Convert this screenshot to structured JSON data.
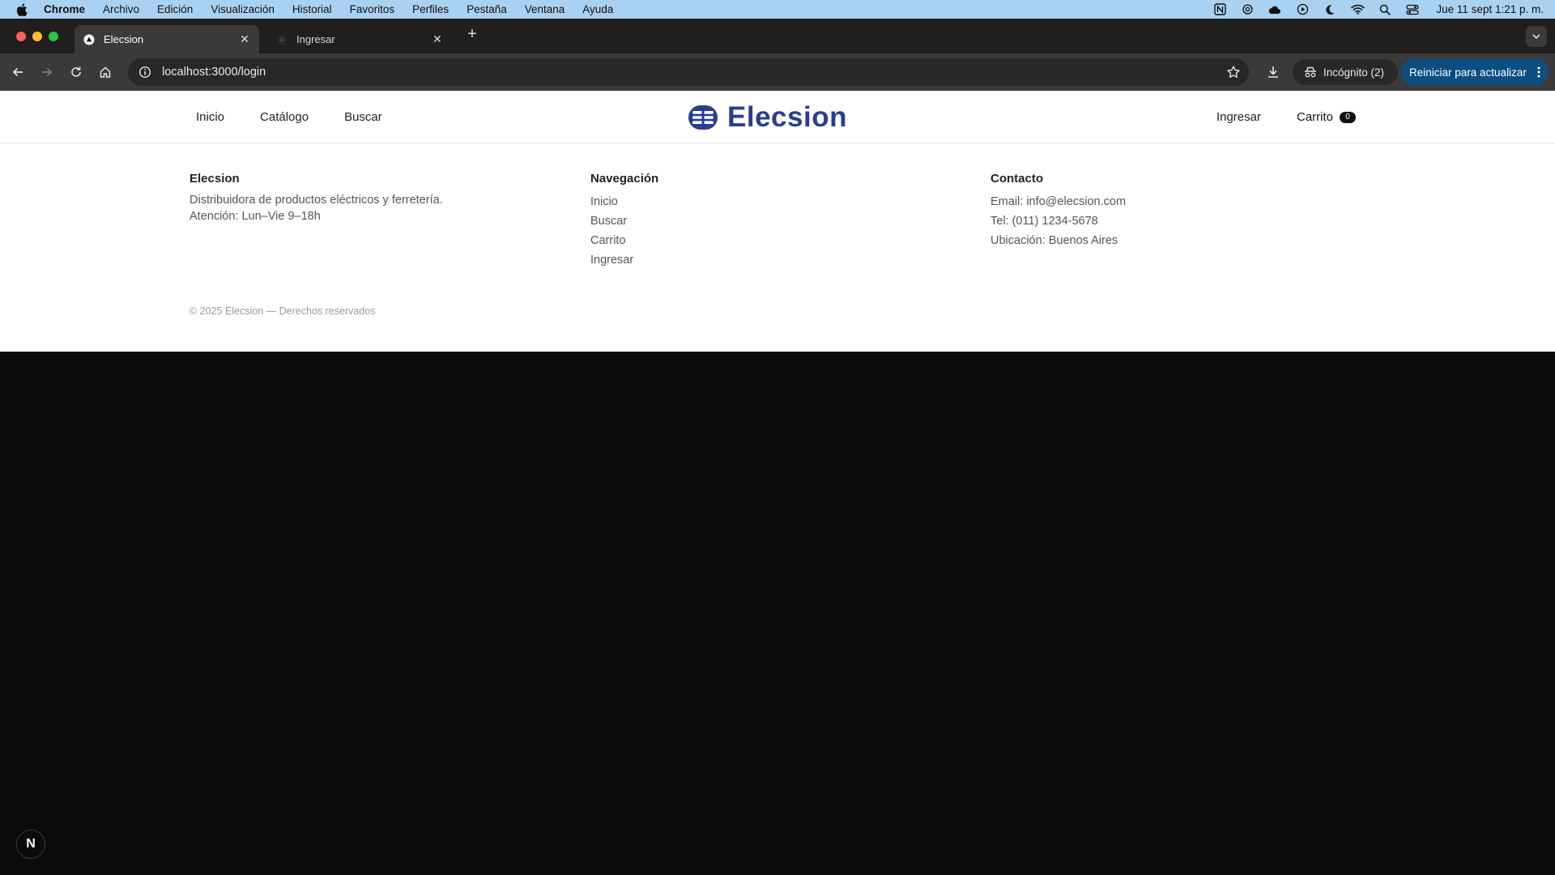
{
  "menubar": {
    "items": [
      "Chrome",
      "Archivo",
      "Edición",
      "Visualización",
      "Historial",
      "Favoritos",
      "Perfiles",
      "Pestaña",
      "Ventana",
      "Ayuda"
    ],
    "clock": "Jue 11 sept  1:21 p. m."
  },
  "browser": {
    "tabs": [
      {
        "title": "Elecsion",
        "active": true
      },
      {
        "title": "Ingresar",
        "active": false
      }
    ],
    "url": "localhost:3000/login",
    "incognito_label": "Incógnito (2)",
    "update_label": "Reiniciar para actualizar"
  },
  "site": {
    "nav_left": [
      "Inicio",
      "Catálogo",
      "Buscar"
    ],
    "logo_text": "Elecsion",
    "login_link": "Ingresar",
    "cart_label": "Carrito",
    "cart_count": "0",
    "brand_color": "#2b3d8f"
  },
  "footer": {
    "about": {
      "title": "Elecsion",
      "line1": "Distribuidora de productos eléctricos y ferretería.",
      "line2": "Atención: Lun–Vie 9–18h"
    },
    "navigation": {
      "title": "Navegación",
      "links": [
        "Inicio",
        "Buscar",
        "Carrito",
        "Ingresar"
      ]
    },
    "contact": {
      "title": "Contacto",
      "email": "Email: info@elecsion.com",
      "phone": "Tel: (011) 1234-5678",
      "location": "Ubicación: Buenos Aires"
    },
    "copyright": "© 2025 Elecsion — Derechos reservados"
  },
  "dev_badge": "N"
}
